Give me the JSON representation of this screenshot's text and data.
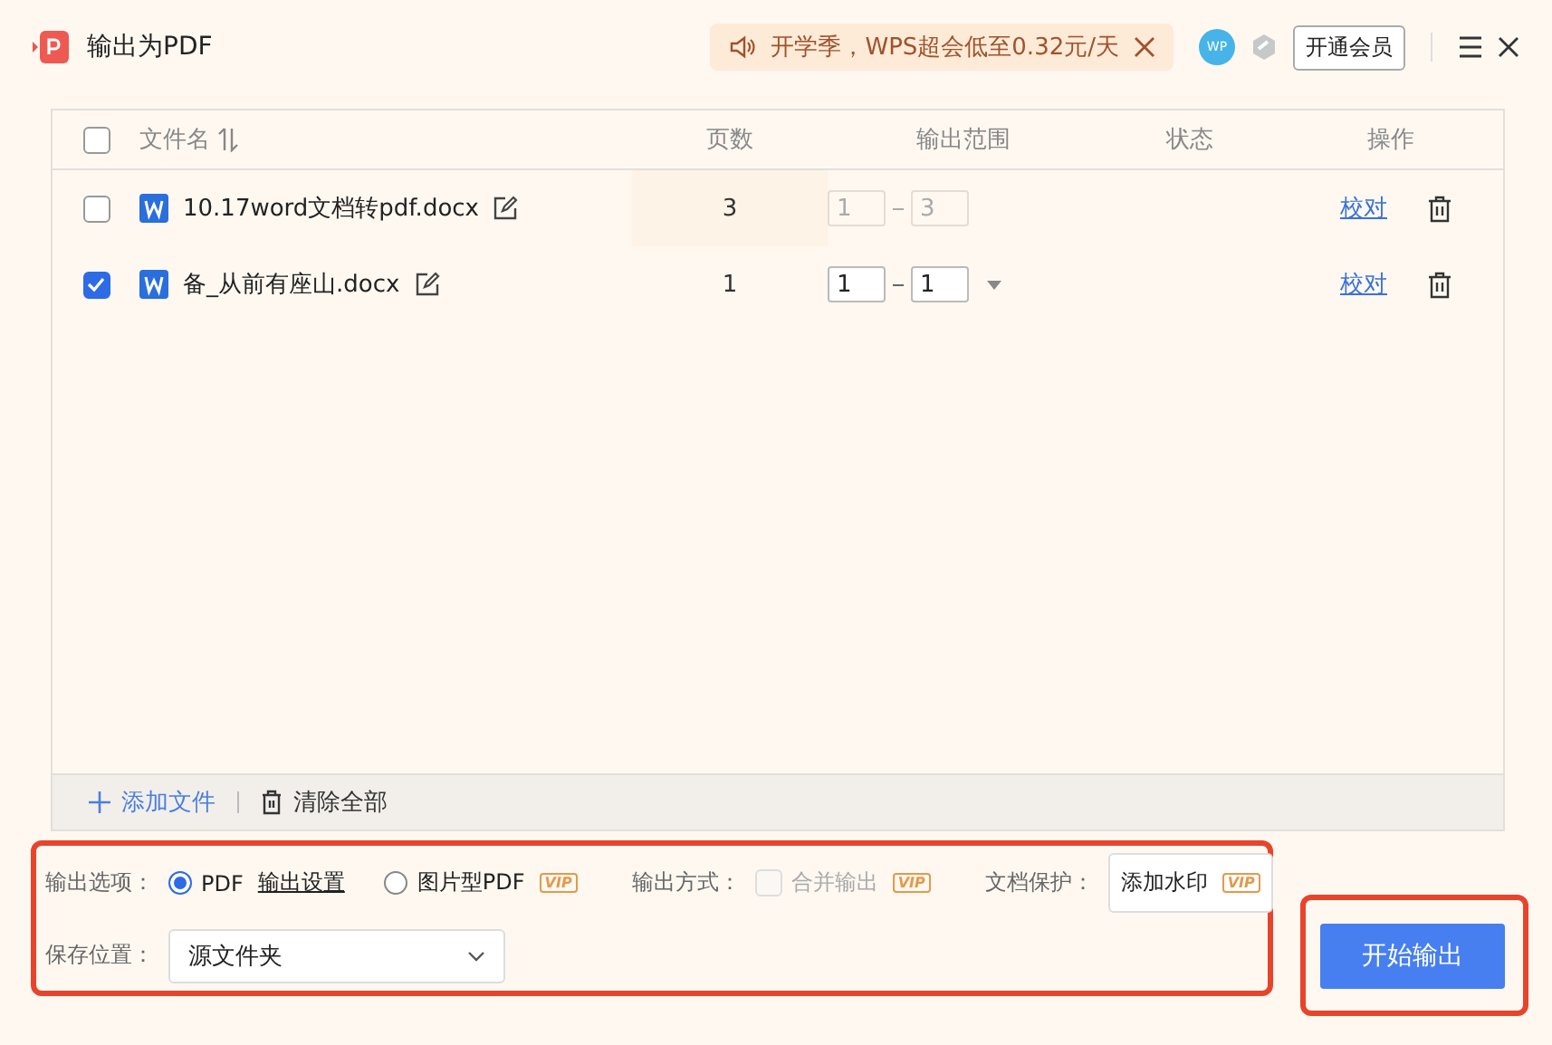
{
  "window": {
    "title": "输出为PDF"
  },
  "promo": {
    "text": "开学季，WPS超会低至0.32元/天"
  },
  "account": {
    "avatar": "WP",
    "member_button": "开通会员"
  },
  "table": {
    "all_checked": false,
    "columns": [
      "文件名",
      "页数",
      "输出范围",
      "状态",
      "操作"
    ],
    "rows": [
      {
        "checked": false,
        "name": "10.17word文档转pdf.docx",
        "pages": "3",
        "range_from": "1",
        "range_to": "3",
        "disabled": true,
        "action": "校对"
      },
      {
        "checked": true,
        "name": "备_从前有座山.docx",
        "pages": "1",
        "range_from": "1",
        "range_to": "1",
        "disabled": false,
        "action": "校对"
      }
    ]
  },
  "footer": {
    "add": "添加文件",
    "clear": "清除全部"
  },
  "options": {
    "label": "输出选项：",
    "radios": [
      {
        "label": "PDF",
        "selected": true,
        "link": "输出设置"
      },
      {
        "label": "图片型PDF",
        "selected": false,
        "vip": "VIP"
      }
    ],
    "mode": {
      "label": "输出方式：",
      "checkbox": "合并输出",
      "checked": false,
      "disabled": true,
      "vip": "VIP"
    },
    "protection": {
      "label": "文档保护：",
      "button": "添加水印",
      "vip": "VIP"
    },
    "save": {
      "label": "保存位置：",
      "value": "源文件夹"
    }
  },
  "start_button": "开始输出"
}
